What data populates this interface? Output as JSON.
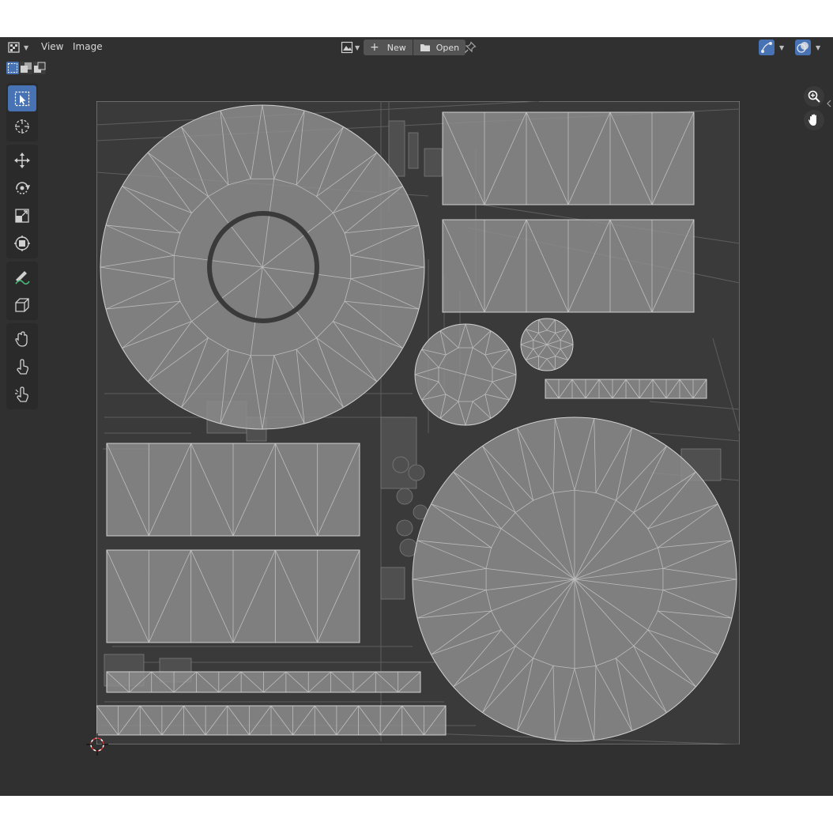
{
  "header": {
    "editor_type_icon": "image-editor-icon",
    "menus": [
      "View",
      "Image"
    ],
    "image_browse_icon": "image-browse-icon",
    "new_label": "New",
    "open_label": "Open",
    "pin_icon": "pin-icon",
    "gizmo_icon": "gizmo-icon",
    "overlay_icon": "overlay-icon"
  },
  "selection_modes": [
    "select-new-icon",
    "select-extend-icon",
    "select-subtract-icon"
  ],
  "tools": [
    {
      "icon": "select-box-icon",
      "active": true
    },
    {
      "icon": "cursor-icon"
    },
    {
      "icon": "move-icon"
    },
    {
      "icon": "rotate-icon"
    },
    {
      "icon": "scale-icon"
    },
    {
      "icon": "transform-icon"
    },
    {
      "icon": "annotate-icon"
    },
    {
      "icon": "rip-region-icon"
    },
    {
      "icon": "grab-icon"
    },
    {
      "icon": "relax-icon"
    },
    {
      "icon": "pinch-icon"
    }
  ],
  "navigation": [
    "zoom-icon",
    "pan-hand-icon"
  ],
  "colors": {
    "background": "#303030",
    "toolbar": "#2a2a2a",
    "accent": "#4772b3",
    "uv_fill": "#8c8c8c",
    "wire": "#d0d0d0"
  }
}
